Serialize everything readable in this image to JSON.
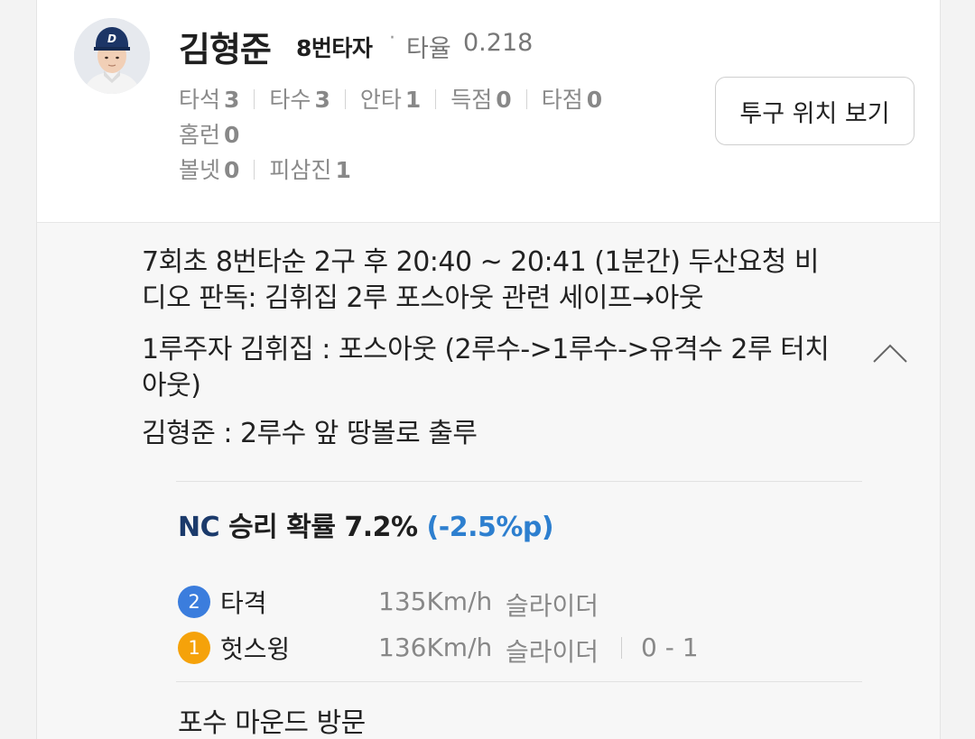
{
  "player": {
    "name": "김형준",
    "bat_order": "8번타자",
    "separator": "·",
    "avg_label": "타율",
    "avg_value": "0.218"
  },
  "stats": {
    "line1": [
      {
        "label": "타석",
        "value": "3"
      },
      {
        "label": "타수",
        "value": "3"
      },
      {
        "label": "안타",
        "value": "1"
      },
      {
        "label": "득점",
        "value": "0"
      },
      {
        "label": "타점",
        "value": "0"
      }
    ],
    "line2": [
      {
        "label": "홈런",
        "value": "0"
      }
    ],
    "line3": [
      {
        "label": "볼넷",
        "value": "0"
      },
      {
        "label": "피삼진",
        "value": "1"
      }
    ]
  },
  "pitch_location_button": "투구 위치 보기",
  "play": {
    "desc1": "7회초 8번타순 2구 후 20:40 ~ 20:41 (1분간) 두산요청 비디오 판독: 김휘집 2루 포스아웃 관련 세이프→아웃",
    "desc2": "1루주자 김휘집 : 포스아웃 (2루수->1루수->유격수 2루 터치아웃)",
    "desc3": "김형준 : 2루수 앞 땅볼로 출루"
  },
  "win_probability": {
    "team": "NC",
    "text": "승리 확률 7.2%",
    "diff": "(-2.5%p)"
  },
  "pitches": [
    {
      "number": "2",
      "result": "타격",
      "speed": "135Km/h",
      "type": "슬라이더",
      "count": "",
      "badge_color": "#3b7ddd"
    },
    {
      "number": "1",
      "result": "헛스윙",
      "speed": "136Km/h",
      "type": "슬라이더",
      "count": "0 - 1",
      "badge_color": "#f5a20a"
    }
  ],
  "next_event": "포수 마운드 방문",
  "icons": {
    "collapse": "chevron-up-icon",
    "avatar": "player-avatar"
  }
}
